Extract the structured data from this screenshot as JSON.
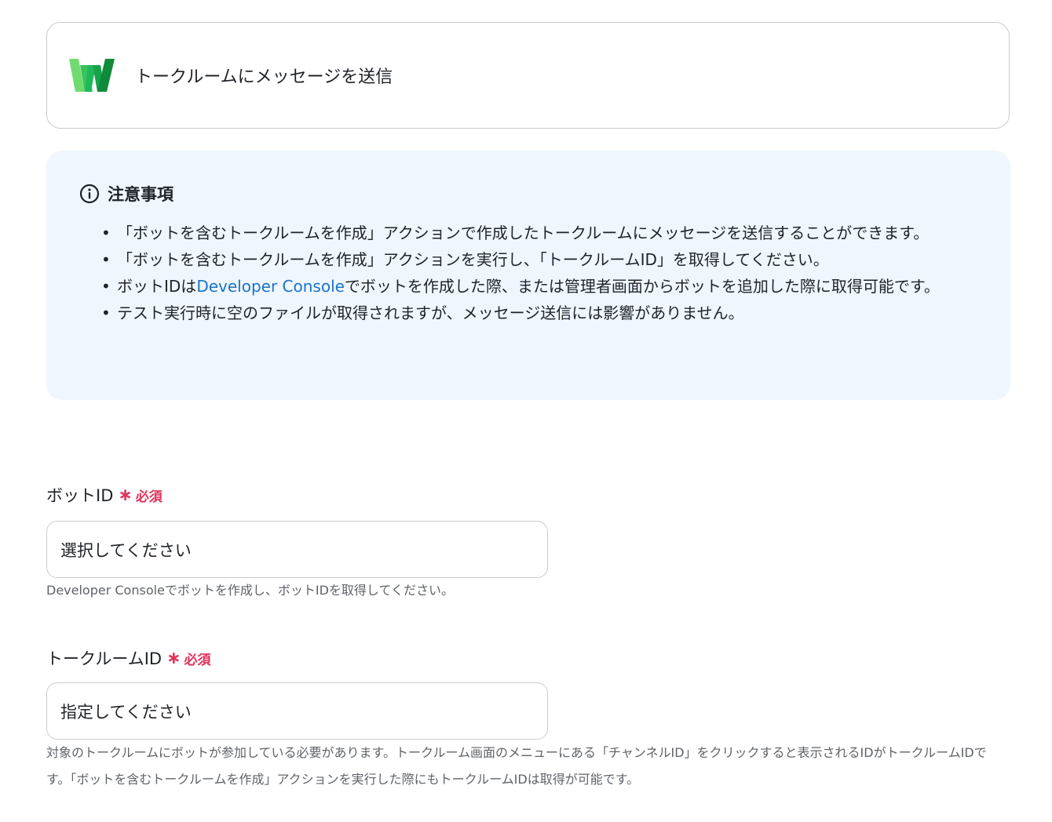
{
  "action": {
    "title": "トークルームにメッセージを送信",
    "logo_icon": "works-w-logo-icon",
    "logo_colors": [
      "#6fdb6f",
      "#1fb85a",
      "#0f8a3a"
    ]
  },
  "notice": {
    "icon": "info-icon",
    "title": "注意事項",
    "items": [
      {
        "text": "「ボットを含むトークルームを作成」アクションで作成したトークルームにメッセージを送信することができます。"
      },
      {
        "text": "「ボットを含むトークルームを作成」アクションを実行し、「トークルームID」を取得してください。"
      },
      {
        "prefix": "ボットIDは",
        "link": "Developer Console",
        "suffix": "でボットを作成した際、または管理者画面からボットを追加した際に取得可能です。"
      },
      {
        "text": "テスト実行時に空のファイルが取得されますが、メッセージ送信には影響がありません。"
      }
    ],
    "background": "#eff6fe",
    "link_color": "#1a73c8"
  },
  "fields": [
    {
      "label": "ボットID",
      "required_mark": "∗",
      "required_text": "必須",
      "placeholder": "選択してください",
      "help": "Developer Consoleでボットを作成し、ボットIDを取得してください。"
    },
    {
      "label": "トークルームID",
      "required_mark": "∗",
      "required_text": "必須",
      "placeholder": "指定してください",
      "help": "対象のトークルームにボットが参加している必要があります。トークルーム画面のメニューにある「チャンネルID」をクリックすると表示されるIDがトークルームIDです。「ボットを含むトークルームを作成」アクションを実行した際にもトークルームIDは取得が可能です。"
    }
  ],
  "required_color": "#e0325b"
}
